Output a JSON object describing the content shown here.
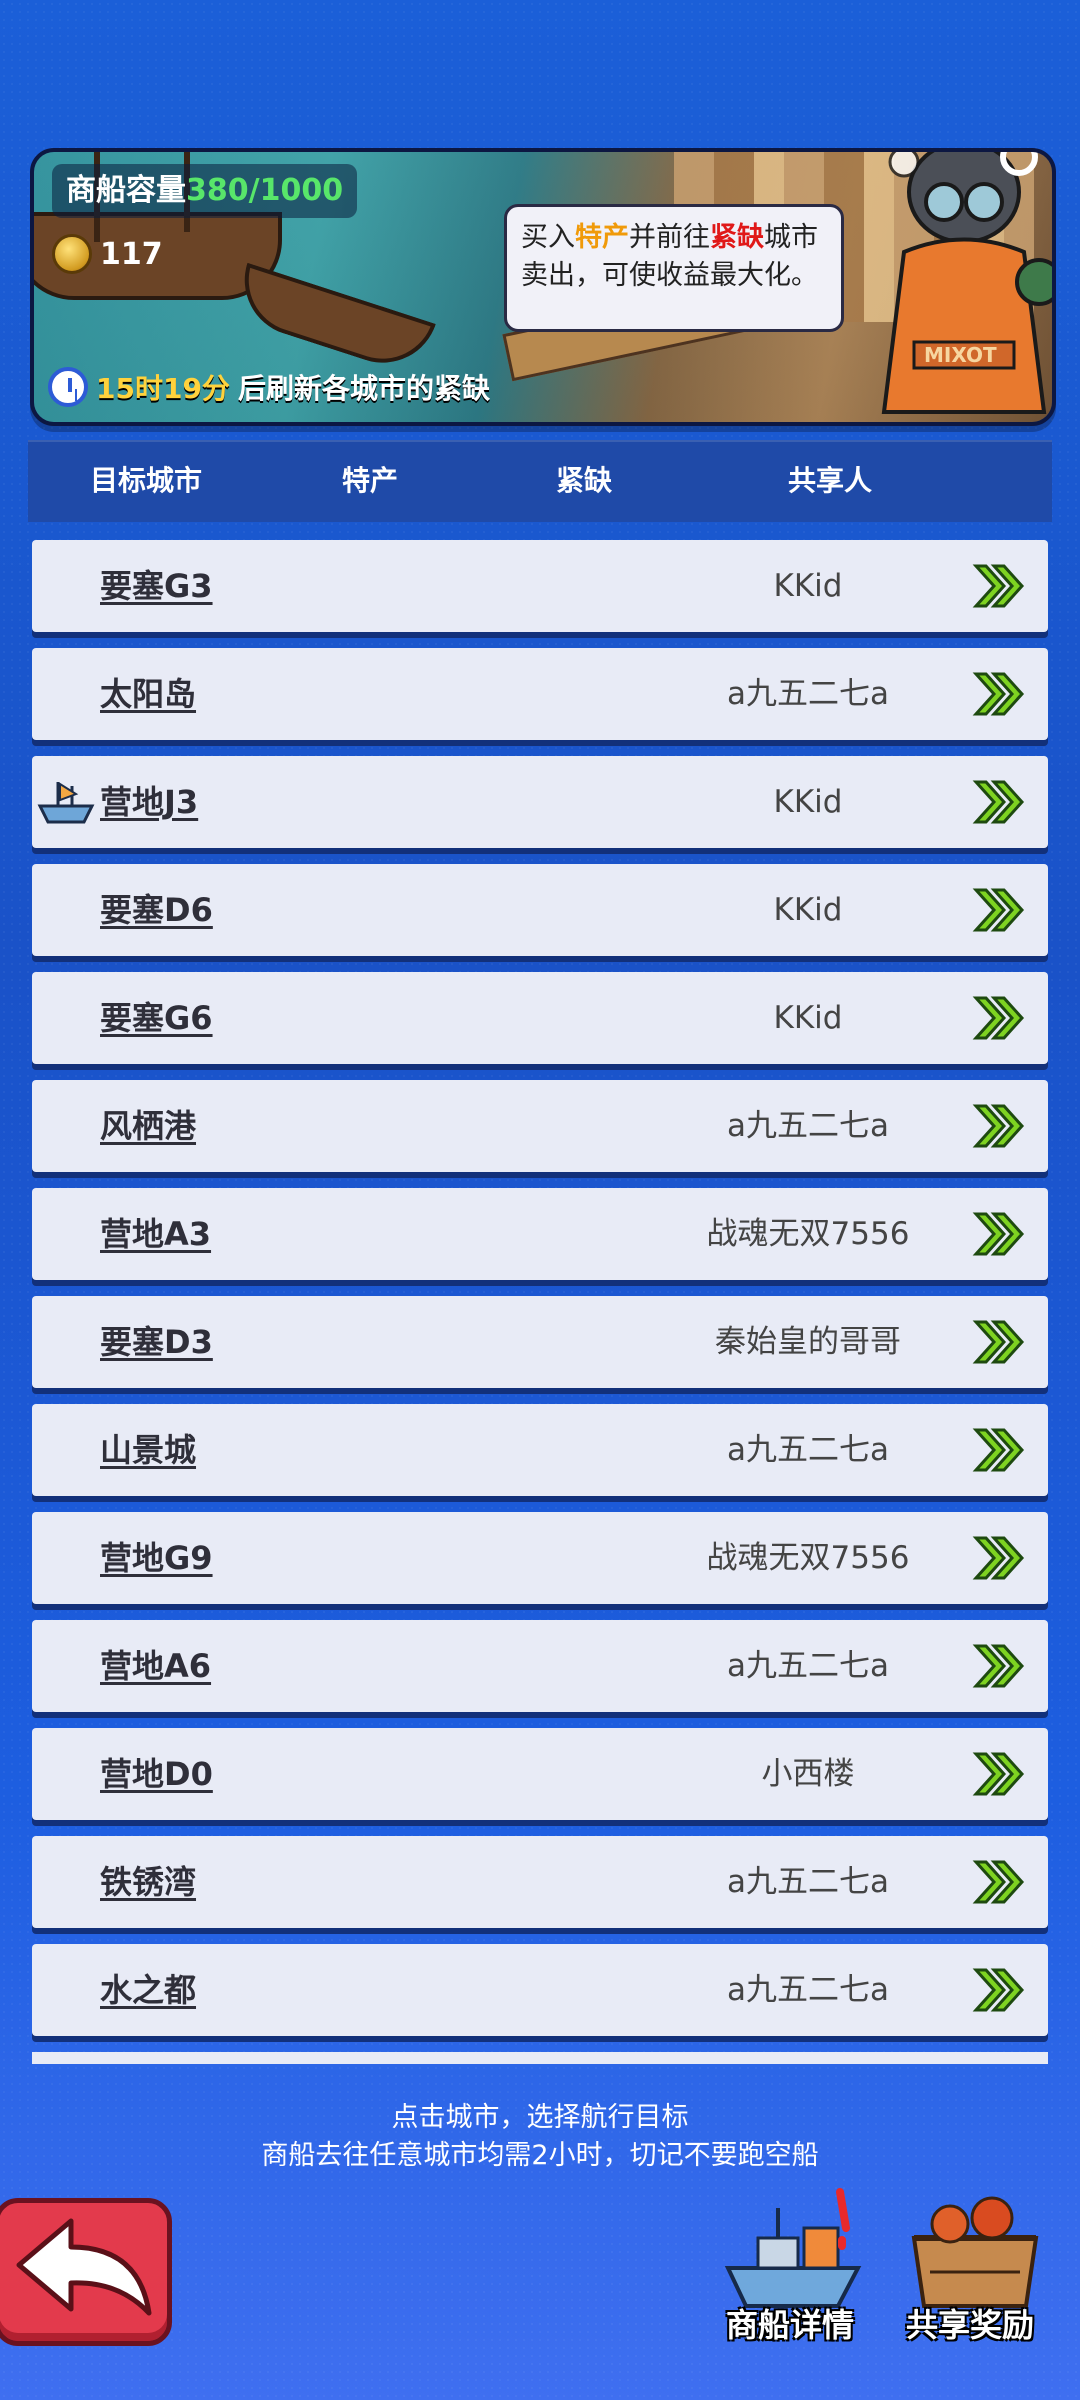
{
  "banner": {
    "capacity_label": "商船容量",
    "capacity_value": "380/1000",
    "coins": "117",
    "tip_1": "买入",
    "tip_special": "特产",
    "tip_2": "并前往",
    "tip_shortage": "紧缺",
    "tip_3": "城市",
    "tip_4": "卖出，可使收益最大化。",
    "timer_value": "15时19分",
    "timer_suffix": "后刷新各城市的紧缺"
  },
  "table": {
    "headers": [
      "目标城市",
      "特产",
      "紧缺",
      "共享人"
    ],
    "rows": [
      {
        "city": "要塞G3",
        "sharer": "KKid"
      },
      {
        "city": "太阳岛",
        "sharer": "a九五二七a"
      },
      {
        "city": "营地J3",
        "sharer": "KKid"
      },
      {
        "city": "要塞D6",
        "sharer": "KKid"
      },
      {
        "city": "要塞G6",
        "sharer": "KKid"
      },
      {
        "city": "风栖港",
        "sharer": "a九五二七a"
      },
      {
        "city": "营地A3",
        "sharer": "战魂无双7556"
      },
      {
        "city": "要塞D3",
        "sharer": "秦始皇的哥哥"
      },
      {
        "city": "山景城",
        "sharer": "a九五二七a"
      },
      {
        "city": "营地G9",
        "sharer": "战魂无双7556"
      },
      {
        "city": "营地A6",
        "sharer": "a九五二七a"
      },
      {
        "city": "营地D0",
        "sharer": "小西楼"
      },
      {
        "city": "铁锈湾",
        "sharer": "a九五二七a"
      },
      {
        "city": "水之都",
        "sharer": "a九五二七a"
      }
    ]
  },
  "hint_line1": "点击城市，选择航行目标",
  "hint_line2": "商船去往任意城市均需2小时，切记不要跑空船",
  "buttons": {
    "ship_details": "商船详情",
    "share_rewards": "共享奖励"
  },
  "icons": {
    "go": "double-chevron-right-icon",
    "current_location": "ship-icon",
    "back": "back-arrow-icon"
  },
  "colors": {
    "capacity_value": "#58e66a",
    "tip_special": "#f09a0a",
    "tip_shortage": "#e01818",
    "timer_value": "#ffd23c",
    "arrow_green": "#7ed321"
  }
}
